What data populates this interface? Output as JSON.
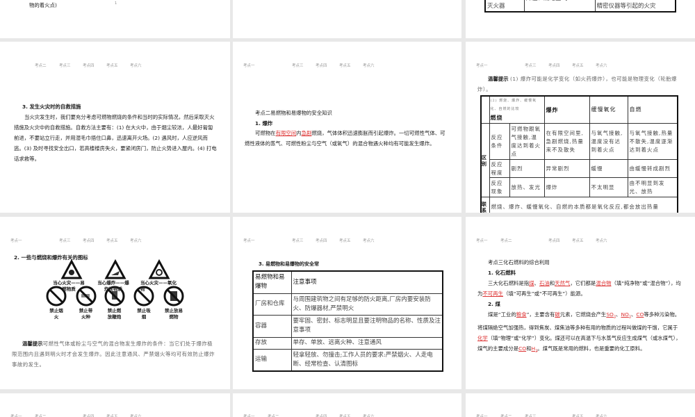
{
  "nav_labels": [
    "考点一",
    "考点二",
    "考点三",
    "考点四",
    "考点五",
    "考点六"
  ],
  "slides": {
    "top_left": {
      "text": "物的着火点)",
      "mark": "1"
    },
    "top_right": {
      "cells": [
        "灭火器",
        "降温、隔绝空气",
        "精密仪器等引起的火灾"
      ]
    },
    "s4": {
      "heading": "3. 发生火灾时的自救措施",
      "body": "当火灾发生时，我们要充分考虑可燃物燃烧的条件和当时的实际情况，然后采取灭火措施及火灾中的自救措施。自救方法主要有：(1) 在大火中，由于烟尘较浓，人最好匍匐前进，不要站立行走，并用湿毛巾捂住口鼻，迅速离开火场。(2) 遇风时，人应逆风而逃。(3) 及时寻找安全出口，若高楼楼房失火，要紧闭房门，防止火势进入屋内。(4) 打电话求救等。"
    },
    "s5": {
      "heading": "考点二易燃物和易爆物的安全知识",
      "sub": "1. 爆炸",
      "pre": "可燃物在",
      "blank1": "有限空间",
      "mid": "内",
      "blank2": "急剧",
      "post": "燃烧，气体体积迅速膨胀而引起爆炸。一切可燃性气体、可燃性液体的蒸气、可燃性粉尘与空气（或氧气）的混合物遇火种均有可能发生爆炸。"
    },
    "s6": {
      "tip_label": "温馨提示",
      "tip": "(1) 爆炸可能是化学变化（如火药爆炸），也可能是物理变化（轮胎爆炸）。",
      "caption": "(2) 燃烧、爆炸、缓慢氧化、自燃的比较",
      "headers": [
        "燃烧",
        "爆炸",
        "缓慢氧化",
        "自燃"
      ],
      "group_diff": "区别",
      "group_link": "联系",
      "rows": [
        {
          "label": "反应条件",
          "cells": [
            "可燃物跟氧气接触,温度达到着火点",
            "在有限空间里,急剧燃烧,热量来不及散失",
            "与氧气接触,温度没有达到着火点",
            "与氧气接触,热量不散失,温度逐渐达到着火点"
          ]
        },
        {
          "label": "反应程度",
          "cells": [
            "剧烈",
            "异常剧烈",
            "缓慢",
            "由缓慢转成剧烈"
          ]
        },
        {
          "label": "反应现象",
          "cells": [
            "放热、发光",
            "爆炸",
            "不太明显",
            "由不明显到发光、放热"
          ]
        }
      ],
      "link_text": "燃烧、爆炸、缓慢氧化、自燃的本质都是氧化反应,都会放出热量"
    },
    "s7": {
      "heading": "2. 一些与燃烧和爆炸有关的图标",
      "warn": [
        "当心火灾——易燃物质",
        "当心爆炸——爆炸性物质",
        "当心火灾——氧化物"
      ],
      "ban": [
        "禁止烟火",
        "禁止带火种",
        "禁止燃放鞭炮",
        "禁止吸烟",
        "禁止放易燃物"
      ],
      "tip_label": "温馨提示",
      "tip": "可燃性气体或粉尘与空气的混合物发生爆炸的条件：当它们处于爆炸极限范围内且遇到明火时才会发生爆炸。因此注意通风、严禁烟火等均可有效防止爆炸事故的发生。"
    },
    "s8": {
      "heading": "3. 易燃物和易爆物的安全常",
      "headers": [
        "易燃物和易爆物",
        "注意事项"
      ],
      "rows": [
        [
          "厂房和仓库",
          "与周围建筑物之间有足够的防火距离,厂房内要安装防火、防爆器材,严禁明火"
        ],
        [
          "容器",
          "要牢固、密封、标志明显且要注明物品的名称、性质及注意事项"
        ],
        [
          "存放",
          "单存、单放、远离火种、注意通风"
        ],
        [
          "运输",
          "轻拿轻放、勿撞击;工作人员的要求:严禁烟火、人走电断、经常检查、认清图标"
        ]
      ]
    },
    "s9": {
      "heading": "考点三化石燃料的综合利用",
      "sub1": "1. 化石燃料",
      "l1a": "三大化石燃料是指",
      "b1": "煤",
      "l1b": "、",
      "b2": "石油",
      "l1c": "和",
      "b3": "天然气",
      "l1d": "，它们都是",
      "b4": "混合物",
      "l1e": "（填“纯净物”或“混合物”），均为",
      "b5": "不可再生",
      "l1f": "（填“可再生”或“不可再生”）能源。",
      "sub2": "2. 煤",
      "l2a": "煤是“工业的",
      "c1": "粮食",
      "l2b": "”，主要含有",
      "c2": "碳",
      "l2c": "元素，它燃烧会产生",
      "c3": "SO",
      "c3s": "2",
      "l2d": "、",
      "c4": "NO",
      "c4s": "2",
      "l2e": "、",
      "c5": "CO",
      "l2f": "等多种污染物。将煤隔绝空气加强热，得到焦炭、煤焦油等多种有用的物质的过程叫做煤的干馏，它属于",
      "c6": "化学",
      "l2g": "（填“物理”或“化学”）变化。煤还可以在高温下与水蒸气反应生成煤气（或水煤气），煤气的主要成分是",
      "c7": "CO",
      "l2h": "和",
      "c8": "H",
      "c8s": "2",
      "l2i": "。煤气既是常用的燃料，也是重要的化工原料。"
    }
  }
}
